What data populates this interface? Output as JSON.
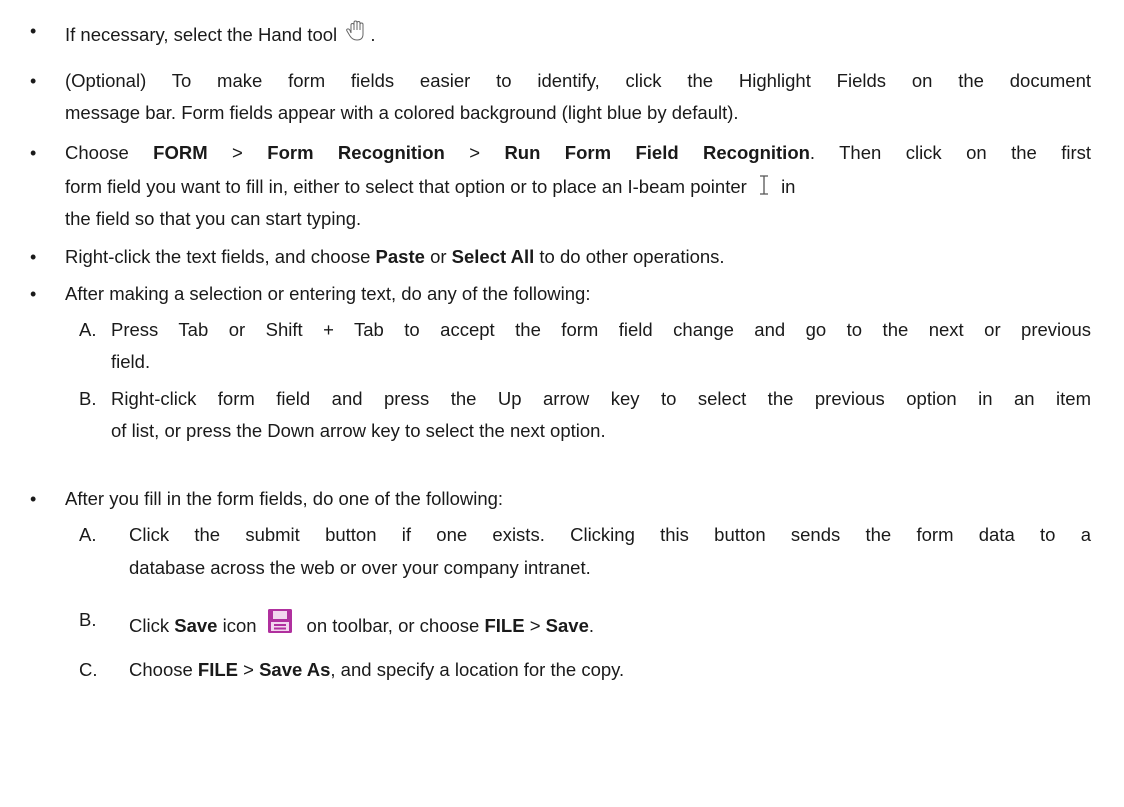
{
  "icons": {
    "hand": "hand-tool-icon",
    "ibeam": "i-beam-pointer-icon",
    "save": "save-floppy-icon",
    "save_color": "#b0309e"
  },
  "items": [
    {
      "a": "If necessary, select the Hand tool",
      "b": "."
    },
    {
      "l1": "(Optional) To make form fields easier to identify, click the Highlight Fields on the document",
      "l2": "message bar. Form fields appear with a colored background (light blue by default)."
    },
    {
      "a": "Choose",
      "b": "FORM",
      "c": ">",
      "d": "Form Recognition",
      "e": ">",
      "f": "Run Form Field Recognition",
      "g": ". Then click on the first",
      "l2a": "form field you want to fill in, either to select that option or to place an I-beam pointer",
      "l2b": "in",
      "l3": "the field so that you can start typing."
    },
    {
      "a": "Right-click the text fields, and choose",
      "b": "Paste",
      "c": "or",
      "d": "Select All",
      "e": "to do other operations."
    },
    {
      "a": "After making a selection or entering text, do any of the following:",
      "subs": [
        {
          "letter": "A.",
          "l1": "Press Tab or Shift + Tab to accept the form field change and go to the next or previous",
          "l2": "field."
        },
        {
          "letter": "B.",
          "l1": "Right-click form field and press the Up arrow key to select the previous option in an item",
          "l2": "of list, or press the Down arrow key to select the next option."
        }
      ]
    },
    {
      "a": "After you fill in the form fields, do one of the following:",
      "subs": [
        {
          "letter": "A.",
          "l1": "Click the submit button if one exists. Clicking this button sends the form data to a",
          "l2": "database across the web or over your company intranet."
        },
        {
          "letter": "B.",
          "a": "Click",
          "b": "Save",
          "c": "icon",
          "d": "on toolbar, or choose",
          "e": "FILE",
          "f": ">",
          "g": "Save",
          "h": "."
        },
        {
          "letter": "C.",
          "a": "Choose",
          "b": "FILE",
          "c": ">",
          "d": "Save As",
          "e": ", and specify a location for the copy."
        }
      ]
    }
  ],
  "bullet_char": "•"
}
